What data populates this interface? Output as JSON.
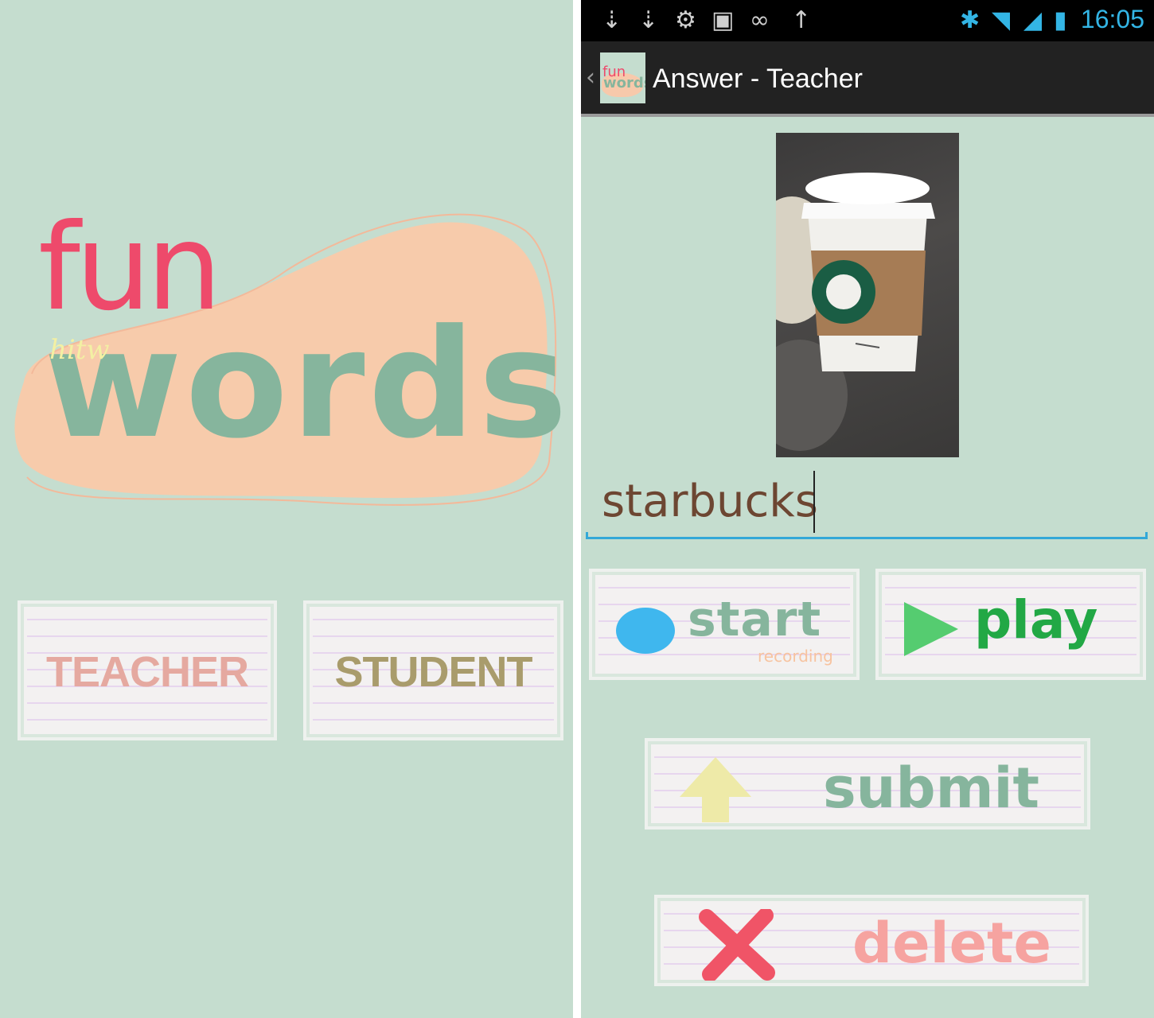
{
  "left_screen": {
    "logo": {
      "fun": "fun",
      "words": "words",
      "hitw": "hitw"
    },
    "teacher_label": "TEACHER",
    "student_label": "STUDENT"
  },
  "status_bar": {
    "time": "16:05",
    "icons": [
      "usb-icon",
      "usb-icon",
      "android-debug-icon",
      "image-icon",
      "voicemail-icon",
      "upload-icon",
      "bluetooth-icon",
      "wifi-icon",
      "signal-icon",
      "battery-icon"
    ]
  },
  "action_bar": {
    "icon_fun": "fun",
    "icon_words": "words",
    "title": "Answer - Teacher"
  },
  "answer": {
    "word": "starbucks"
  },
  "buttons": {
    "start": "start",
    "recording": "recording",
    "play": "play",
    "submit": "submit",
    "delete": "delete"
  },
  "colors": {
    "background": "#c5ddcf",
    "accent_blue": "#33b5e5",
    "logo_pink": "#ee4a6b",
    "logo_green": "#86b59d",
    "blob_peach": "#f7c9ab"
  }
}
